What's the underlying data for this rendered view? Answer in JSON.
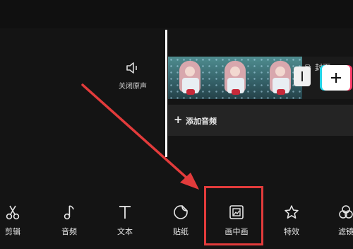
{
  "timeline": {
    "mute_label": "关闭原声",
    "cover_label": "封面",
    "add_audio_label": "添加音频",
    "frames": [
      "clip-frame-1",
      "clip-frame-2",
      "clip-frame-3"
    ]
  },
  "toolbar": {
    "items": [
      {
        "label": "剪辑",
        "icon": "scissors-icon"
      },
      {
        "label": "音频",
        "icon": "music-note-icon"
      },
      {
        "label": "文本",
        "icon": "text-t-icon"
      },
      {
        "label": "贴纸",
        "icon": "sticker-icon"
      },
      {
        "label": "画中画",
        "icon": "picture-in-picture-icon"
      },
      {
        "label": "特效",
        "icon": "star-effects-icon"
      },
      {
        "label": "滤镜",
        "icon": "filter-icon"
      }
    ]
  },
  "annotation": {
    "highlight_color": "#e23b3b"
  }
}
